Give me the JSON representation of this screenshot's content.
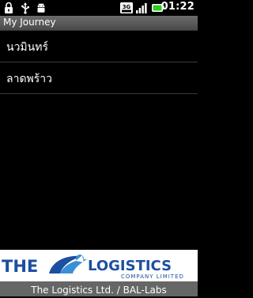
{
  "status_bar": {
    "time": "01:22",
    "network_label": "3G",
    "icons": [
      "lock-icon",
      "usb-icon",
      "android-icon",
      "3g-icon",
      "signal-icon",
      "battery-icon"
    ]
  },
  "app": {
    "title": "My Journey"
  },
  "list": {
    "items": [
      {
        "label": "นวมินทร์"
      },
      {
        "label": "ลาดพร้าว"
      }
    ]
  },
  "banner": {
    "brand_left": "THE",
    "brand_right": "LOGISTICS",
    "brand_sub": "COMPANY LIMITED",
    "brand_color": "#1c4fa0"
  },
  "footer": {
    "text": "The Logistics Ltd. / BAL-Labs"
  }
}
